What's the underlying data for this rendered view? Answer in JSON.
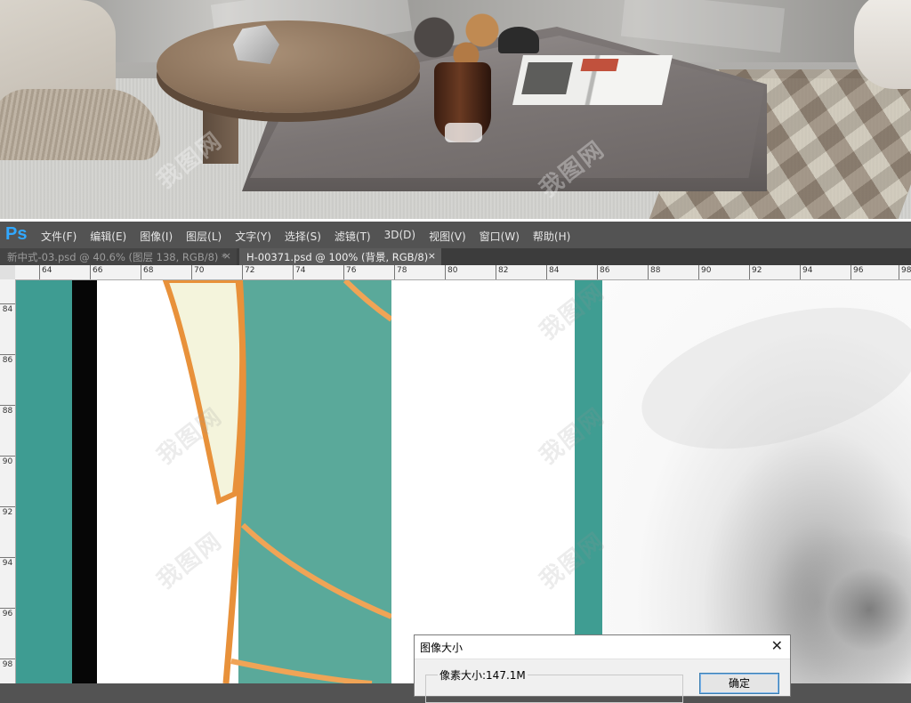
{
  "app": {
    "logo": "Ps",
    "menu": [
      "文件(F)",
      "编辑(E)",
      "图像(I)",
      "图层(L)",
      "文字(Y)",
      "选择(S)",
      "滤镜(T)",
      "3D(D)",
      "视图(V)",
      "窗口(W)",
      "帮助(H)"
    ]
  },
  "tabs": [
    {
      "label": "新中式-03.psd @ 40.6% (图层 138, RGB/8) *",
      "close": "×",
      "active": false
    },
    {
      "label": "H-00371.psd @ 100% (背景, RGB/8)",
      "close": "×",
      "active": true
    }
  ],
  "ruler_top": [
    "64",
    "66",
    "68",
    "70",
    "72",
    "74",
    "76",
    "78",
    "80",
    "82",
    "84",
    "86",
    "88",
    "90",
    "92",
    "94",
    "96",
    "98"
  ],
  "ruler_left": [
    "84",
    "86",
    "88",
    "90",
    "92",
    "94",
    "96",
    "98"
  ],
  "dialog": {
    "title": "图像大小",
    "close": "✕",
    "pixel_size_label": "像素大小:147.1M",
    "ok_label": "确定"
  },
  "watermark": {
    "text": "我图网"
  },
  "colors": {
    "ps_bg": "#535353",
    "ps_blue": "#31a8ff",
    "teal": "#3e9c92",
    "leaf_teal": "#5aa99a",
    "leaf_orange": "#e8913a",
    "leaf_cream": "#f4f4dc"
  }
}
